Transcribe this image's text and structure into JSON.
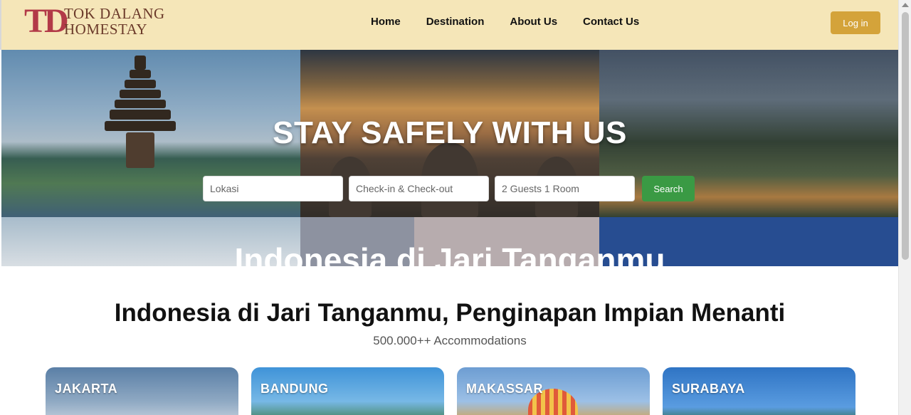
{
  "brand": {
    "mark": "TD",
    "line1": "TOK DALANG",
    "line2": "HOMESTAY"
  },
  "nav": {
    "items": [
      "Home",
      "Destination",
      "About Us",
      "Contact Us"
    ]
  },
  "header": {
    "login_label": "Log in"
  },
  "hero": {
    "title": "STAY SAFELY WITH US",
    "subtitle": "Indonesia di Jari Tanganmu",
    "search": {
      "location_placeholder": "Lokasi",
      "dates_placeholder": "Check-in & Check-out",
      "guests_placeholder": "2 Guests 1 Room",
      "button_label": "Search"
    }
  },
  "section": {
    "title": "Indonesia di Jari Tanganmu, Penginapan Impian Menanti",
    "subtitle": "500.000++ Accommodations"
  },
  "cities": [
    "JAKARTA",
    "BANDUNG",
    "MAKASSAR",
    "SURABAYA"
  ],
  "colors": {
    "header_bg": "#f5e6b8",
    "login": "#d4a33a",
    "search": "#3a9a44",
    "logo": "#b23a48"
  }
}
